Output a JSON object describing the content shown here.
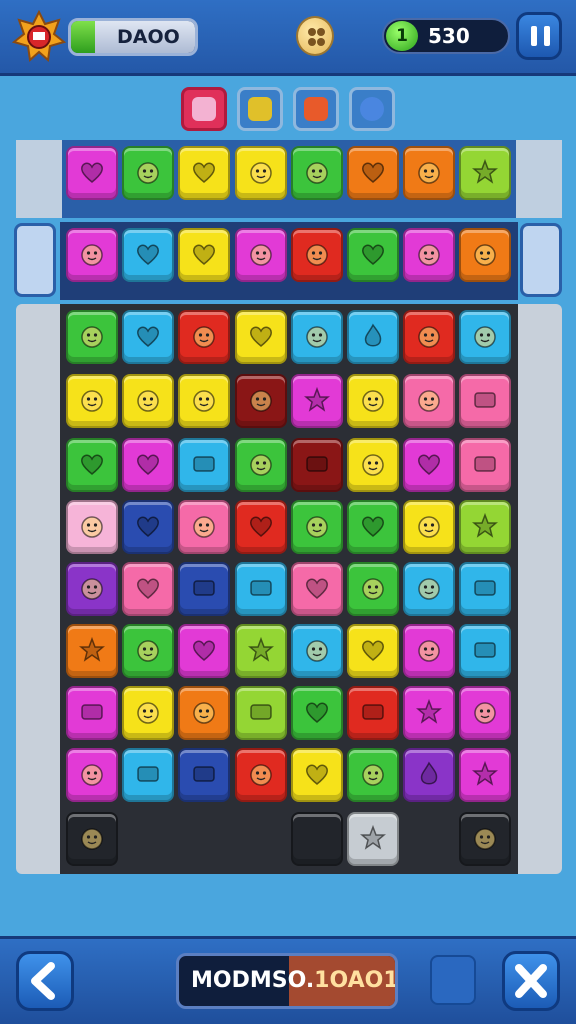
{
  "header": {
    "level_label": "DAOO",
    "level_progress": 0.12,
    "coins": "530",
    "coin_icon_glyph": "1"
  },
  "footer": {
    "score_label_left": "MODMSO.",
    "score_label_right": "1OAO1"
  },
  "colors": {
    "magenta": "#e23ad6",
    "green": "#3cc43c",
    "yellow": "#f6e21a",
    "orange": "#f07a16",
    "red": "#e02a20",
    "cyan": "#30b6ea",
    "lime": "#94d634",
    "pink": "#f56aa8",
    "purple": "#8a34c8",
    "navy": "#2a4cb0",
    "darkred": "#8a1616",
    "lightpink": "#f6b4d8",
    "gray": "#c6ccd2"
  },
  "rows": [
    [
      "magenta:heart",
      "green:face",
      "yellow:heart",
      "yellow:face",
      "green:face",
      "orange:heart",
      "orange:face",
      "lime:star"
    ],
    [
      "magenta:face",
      "cyan:heart",
      "yellow:heart",
      "magenta:face",
      "red:face",
      "green:heart",
      "magenta:face",
      "orange:face"
    ],
    [
      "green:face",
      "cyan:heart",
      "red:face",
      "yellow:heart",
      "cyan:face",
      "cyan:flame",
      "red:face",
      "cyan:face"
    ],
    [
      "yellow:face",
      "yellow:face",
      "yellow:face",
      "darkred:face",
      "magenta:star",
      "yellow:face",
      "pink:face",
      "pink:box"
    ],
    [
      "green:heart",
      "magenta:heart",
      "cyan:box",
      "green:face",
      "darkred:box",
      "yellow:face",
      "magenta:heart",
      "pink:box"
    ],
    [
      "lightpink:face",
      "navy:heart",
      "pink:face",
      "red:heart",
      "green:face",
      "green:heart",
      "yellow:face",
      "lime:star"
    ],
    [
      "purple:face",
      "pink:heart",
      "navy:box",
      "cyan:box",
      "pink:heart",
      "green:face",
      "cyan:face",
      "cyan:box"
    ],
    [
      "orange:star",
      "green:face",
      "magenta:heart",
      "lime:star",
      "cyan:face",
      "yellow:heart",
      "magenta:face",
      "cyan:box"
    ],
    [
      "magenta:box",
      "yellow:face",
      "orange:face",
      "lime:box",
      "green:heart",
      "red:box",
      "magenta:star",
      "magenta:face"
    ],
    [
      "magenta:face",
      "cyan:box",
      "navy:box",
      "red:face",
      "yellow:heart",
      "green:face",
      "purple:flame",
      "magenta:star"
    ]
  ],
  "last_row": [
    {
      "col": 0,
      "tile": "dark:face"
    },
    {
      "col": 4,
      "tile": "dark:empty"
    },
    {
      "col": 5,
      "tile": "gray:star"
    },
    {
      "col": 7,
      "tile": "dark:face"
    }
  ]
}
